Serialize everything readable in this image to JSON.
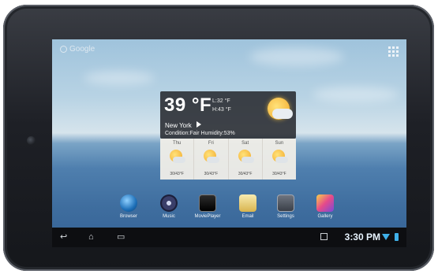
{
  "search": {
    "label": "Google"
  },
  "weather": {
    "temperature": "39 °F",
    "low": "L:32 °F",
    "high": "H:43 °F",
    "city": "New York",
    "condition": "Condition:Fair Humidity:53%",
    "forecast": [
      {
        "day": "Thu",
        "temp": "30/43°F"
      },
      {
        "day": "Fri",
        "temp": "30/43°F"
      },
      {
        "day": "Sat",
        "temp": "30/43°F"
      },
      {
        "day": "Sun",
        "temp": "30/43°F"
      }
    ]
  },
  "dock": [
    {
      "label": "Browser",
      "icon": "globe-icon"
    },
    {
      "label": "Music",
      "icon": "speaker-icon"
    },
    {
      "label": "MoviePlayer",
      "icon": "clapperboard-icon"
    },
    {
      "label": "Email",
      "icon": "envelope-icon"
    },
    {
      "label": "Settings",
      "icon": "settings-icon"
    },
    {
      "label": "Gallery",
      "icon": "gallery-icon"
    }
  ],
  "statusbar": {
    "time": "3:30 PM"
  }
}
